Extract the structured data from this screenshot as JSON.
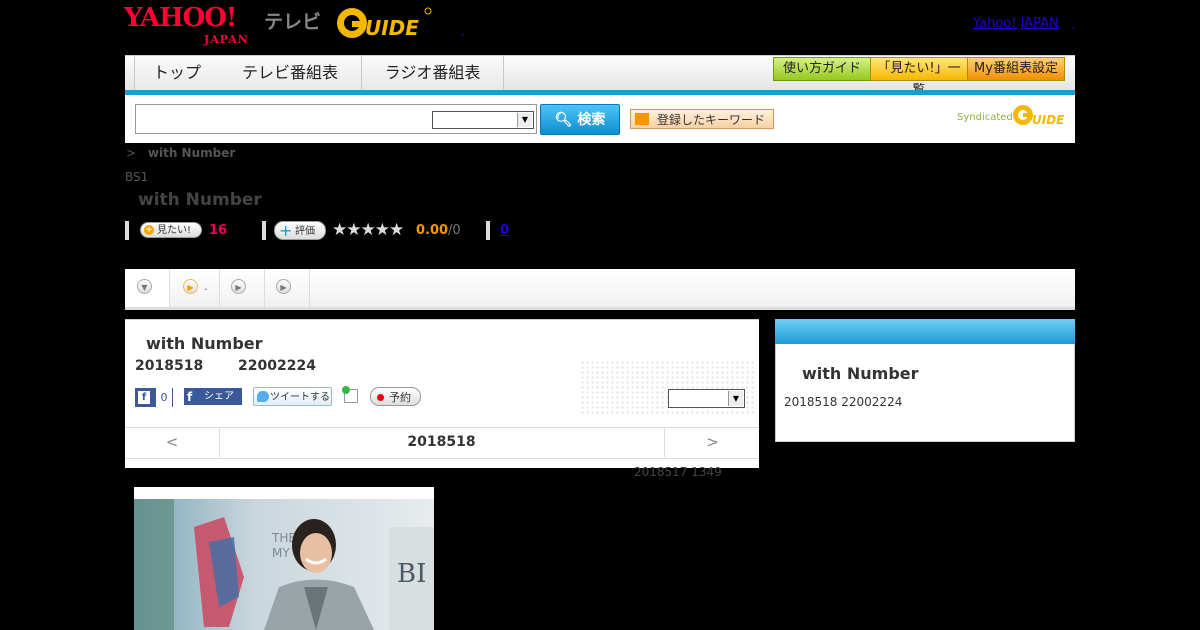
{
  "header": {
    "logo_yahoo": "YAHOO!",
    "logo_japan": "JAPAN",
    "logo_tv": "テレビ",
    "logo_gguide": "G GUIDE",
    "yahoo_japan_link": "Yahoo! JAPAN",
    "sep_dot": ",",
    "sep_dot2": "."
  },
  "nav": {
    "tabs": [
      {
        "label": "トップ"
      },
      {
        "label": "テレビ番組表"
      },
      {
        "label": "ラジオ番組表"
      }
    ],
    "guide_button": "使い方ガイド",
    "mitai_list_button": "「見たい!」一覧",
    "my_settings_button": "My番組表設定"
  },
  "search": {
    "input_value": "",
    "select_value": "",
    "button_label": "検索",
    "keyword_button": "登録したキーワード",
    "syndicated_label": "Syndicated"
  },
  "breadcrumb": {
    "sep": ">",
    "current": "with Number"
  },
  "program": {
    "channel": "BS1",
    "title": "with Number",
    "mitai_label": "見たい!",
    "mitai_count": "16",
    "hyoka_label": "評価",
    "stars": "★★★★★",
    "rating": "0.00",
    "rating_count": "/0",
    "link_count": "0"
  },
  "tabstrip": {
    "tab2_text": "."
  },
  "detail": {
    "title": "with Number",
    "date": "2018518",
    "time": "22002224",
    "fb_like_count": "0",
    "fb_share_label": "シェア",
    "tweet_label": "ツイートする",
    "reserve_label": "予約",
    "select_value": ""
  },
  "pager": {
    "prev": "<",
    "date": "2018518",
    "next": ">"
  },
  "updated_text": "2018517  1349",
  "right_panel": {
    "title": "with Number",
    "sub": "2018518  22002224"
  },
  "colors": {
    "accent_blue": "#1e9ad6",
    "yahoo_red": "#ff0033",
    "count_pink": "#e5005a",
    "rating_orange": "#f39800"
  }
}
